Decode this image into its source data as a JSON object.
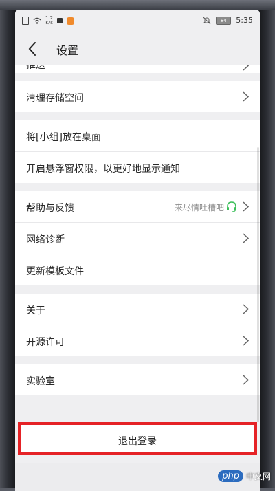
{
  "status_bar": {
    "network_speed_value": "1.2",
    "network_speed_unit": "K/s",
    "battery": "84",
    "time": "5:35"
  },
  "header": {
    "title": "设置"
  },
  "sections": [
    {
      "items": [
        {
          "label": "清理存储空间",
          "chevron": true
        }
      ]
    },
    {
      "items": [
        {
          "label": "将[小组]放在桌面",
          "chevron": false
        },
        {
          "label": "开启悬浮窗权限，以更好地显示通知",
          "chevron": false
        }
      ]
    },
    {
      "items": [
        {
          "label": "帮助与反馈",
          "hint": "来尽情吐槽吧",
          "chevron": true
        },
        {
          "label": "网络诊断",
          "chevron": true
        },
        {
          "label": "更新模板文件",
          "chevron": false
        }
      ]
    },
    {
      "items": [
        {
          "label": "关于",
          "chevron": true
        },
        {
          "label": "开源许可",
          "chevron": true
        }
      ]
    },
    {
      "items": [
        {
          "label": "实验室",
          "chevron": true
        }
      ]
    }
  ],
  "partial_item": {
    "label": "推送"
  },
  "logout": {
    "label": "退出登录"
  },
  "watermark": {
    "badge": "php",
    "text": "中文网"
  },
  "colors": {
    "highlight_border": "#e52226",
    "headset_icon": "#3cbf5a",
    "screen_bg": "#efeff1"
  },
  "icons": [
    "back-arrow-icon",
    "chevron-right-icon",
    "headset-icon",
    "wifi-icon",
    "mute-icon",
    "battery-icon"
  ]
}
